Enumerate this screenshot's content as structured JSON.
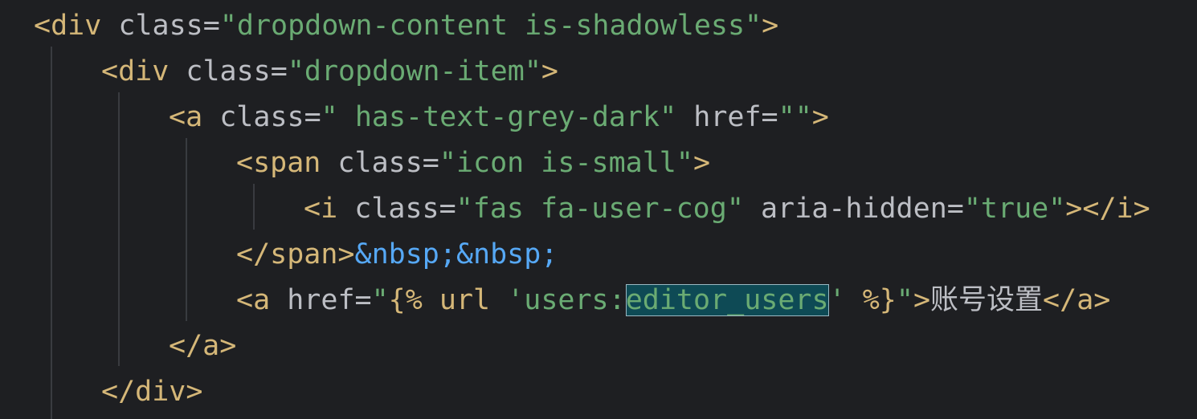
{
  "lines": [
    {
      "indent": "  ",
      "tokens": [
        {
          "cls": "tag",
          "text": "<div"
        },
        {
          "cls": "attr",
          "text": " class"
        },
        {
          "cls": "eq",
          "text": "="
        },
        {
          "cls": "str",
          "text": "\"dropdown-content is-shadowless\""
        },
        {
          "cls": "tag",
          "text": ">"
        }
      ]
    },
    {
      "indent": "      ",
      "tokens": [
        {
          "cls": "tag",
          "text": "<div"
        },
        {
          "cls": "attr",
          "text": " class"
        },
        {
          "cls": "eq",
          "text": "="
        },
        {
          "cls": "str",
          "text": "\"dropdown-item\""
        },
        {
          "cls": "tag",
          "text": ">"
        }
      ]
    },
    {
      "indent": "          ",
      "tokens": [
        {
          "cls": "tag",
          "text": "<a"
        },
        {
          "cls": "attr",
          "text": " class"
        },
        {
          "cls": "eq",
          "text": "="
        },
        {
          "cls": "str",
          "text": "\" has-text-grey-dark\""
        },
        {
          "cls": "attr",
          "text": " href"
        },
        {
          "cls": "eq",
          "text": "="
        },
        {
          "cls": "str",
          "text": "\"\""
        },
        {
          "cls": "tag",
          "text": ">"
        }
      ]
    },
    {
      "indent": "              ",
      "tokens": [
        {
          "cls": "tag",
          "text": "<span"
        },
        {
          "cls": "attr",
          "text": " class"
        },
        {
          "cls": "eq",
          "text": "="
        },
        {
          "cls": "str",
          "text": "\"icon is-small\""
        },
        {
          "cls": "tag",
          "text": ">"
        }
      ]
    },
    {
      "indent": "                  ",
      "tokens": [
        {
          "cls": "tag",
          "text": "<i"
        },
        {
          "cls": "attr",
          "text": " class"
        },
        {
          "cls": "eq",
          "text": "="
        },
        {
          "cls": "str",
          "text": "\"fas fa-user-cog\""
        },
        {
          "cls": "attr",
          "text": " aria-hidden"
        },
        {
          "cls": "eq",
          "text": "="
        },
        {
          "cls": "str",
          "text": "\"true\""
        },
        {
          "cls": "tag",
          "text": "></i>"
        }
      ]
    },
    {
      "indent": "              ",
      "tokens": [
        {
          "cls": "tag",
          "text": "</span>"
        },
        {
          "cls": "entity",
          "text": "&nbsp;&nbsp;"
        }
      ]
    },
    {
      "indent": "              ",
      "tokens": [
        {
          "cls": "tag",
          "text": "<a"
        },
        {
          "cls": "attr",
          "text": " href"
        },
        {
          "cls": "eq",
          "text": "="
        },
        {
          "cls": "str",
          "text": "\""
        },
        {
          "cls": "tpl",
          "text": "{% url "
        },
        {
          "cls": "str",
          "text": "'users:"
        },
        {
          "cls": "sel",
          "text": "editor_users"
        },
        {
          "cls": "str",
          "text": "'"
        },
        {
          "cls": "tpl",
          "text": " %}"
        },
        {
          "cls": "str",
          "text": "\""
        },
        {
          "cls": "tag",
          "text": ">"
        },
        {
          "cls": "text cjk",
          "text": "账号设置"
        },
        {
          "cls": "tag",
          "text": "</a>"
        }
      ]
    },
    {
      "indent": "          ",
      "tokens": [
        {
          "cls": "tag",
          "text": "</a>"
        }
      ]
    },
    {
      "indent": "      ",
      "tokens": [
        {
          "cls": "tag",
          "text": "</div>"
        }
      ]
    }
  ]
}
